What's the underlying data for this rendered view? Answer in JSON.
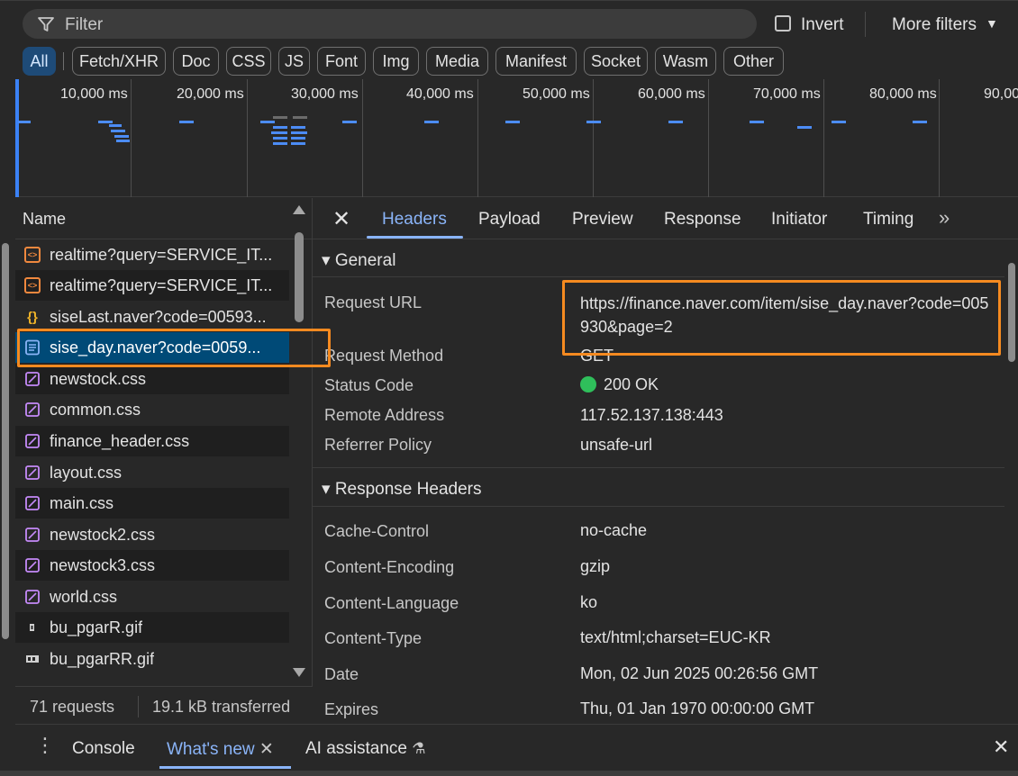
{
  "filter": {
    "placeholder": "Filter",
    "invert_label": "Invert",
    "more_filters_label": "More filters",
    "caret": "▼"
  },
  "types": [
    "All",
    "Fetch/XHR",
    "Doc",
    "CSS",
    "JS",
    "Font",
    "Img",
    "Media",
    "Manifest",
    "Socket",
    "Wasm",
    "Other"
  ],
  "timeline": {
    "labels": [
      "10,000 ms",
      "20,000 ms",
      "30,000 ms",
      "40,000 ms",
      "50,000 ms",
      "60,000 ms",
      "70,000 ms",
      "80,000 ms",
      "90,000 ms"
    ]
  },
  "request_list": {
    "header": "Name",
    "rows": [
      {
        "name": "realtime?query=SERVICE_IT...",
        "type": "xhr",
        "icon": "xhr-icon"
      },
      {
        "name": "realtime?query=SERVICE_IT...",
        "type": "xhr",
        "icon": "xhr-icon"
      },
      {
        "name": "siseLast.naver?code=00593...",
        "type": "js",
        "icon": "script-icon"
      },
      {
        "name": "sise_day.naver?code=0059...",
        "type": "doc",
        "icon": "document-icon",
        "selected": true
      },
      {
        "name": "newstock.css",
        "type": "css",
        "icon": "stylesheet-icon"
      },
      {
        "name": "common.css",
        "type": "css",
        "icon": "stylesheet-icon"
      },
      {
        "name": "finance_header.css",
        "type": "css",
        "icon": "stylesheet-icon"
      },
      {
        "name": "layout.css",
        "type": "css",
        "icon": "stylesheet-icon"
      },
      {
        "name": "main.css",
        "type": "css",
        "icon": "stylesheet-icon"
      },
      {
        "name": "newstock2.css",
        "type": "css",
        "icon": "stylesheet-icon"
      },
      {
        "name": "newstock3.css",
        "type": "css",
        "icon": "stylesheet-icon"
      },
      {
        "name": "world.css",
        "type": "css",
        "icon": "stylesheet-icon"
      },
      {
        "name": "bu_pgarR.gif",
        "type": "img",
        "icon": "image-icon"
      },
      {
        "name": "bu_pgarRR.gif",
        "type": "img",
        "icon": "image-icon"
      }
    ]
  },
  "status_bar": {
    "requests": "71 requests",
    "transferred": "19.1 kB transferred"
  },
  "details": {
    "tabs": [
      "Headers",
      "Payload",
      "Preview",
      "Response",
      "Initiator",
      "Timing"
    ],
    "active_tab": "Headers",
    "more_tabs": "»",
    "general": {
      "title": "▾ General",
      "request_url_label": "Request URL",
      "request_url": "https://finance.naver.com/item/sise_day.naver?code=005930&page=2",
      "request_method_label": "Request Method",
      "request_method": "GET",
      "status_code_label": "Status Code",
      "status_code": "200 OK",
      "remote_address_label": "Remote Address",
      "remote_address": "117.52.137.138:443",
      "referrer_policy_label": "Referrer Policy",
      "referrer_policy": "unsafe-url"
    },
    "response_headers": {
      "title": "▾ Response Headers",
      "items": [
        {
          "key": "Cache-Control",
          "value": "no-cache"
        },
        {
          "key": "Content-Encoding",
          "value": "gzip"
        },
        {
          "key": "Content-Language",
          "value": "ko"
        },
        {
          "key": "Content-Type",
          "value": "text/html;charset=EUC-KR"
        },
        {
          "key": "Date",
          "value": "Mon, 02 Jun 2025 00:26:56 GMT"
        },
        {
          "key": "Expires",
          "value": "Thu, 01 Jan 1970 00:00:00 GMT"
        }
      ]
    }
  },
  "drawer": {
    "tabs": [
      "Console",
      "What's new",
      "AI assistance"
    ],
    "active_tab": "What's new"
  },
  "colors": {
    "accent": "#8ab4f8",
    "highlight": "#f58a20",
    "status_ok": "#2fbf5b",
    "selected_row": "#004a77"
  }
}
